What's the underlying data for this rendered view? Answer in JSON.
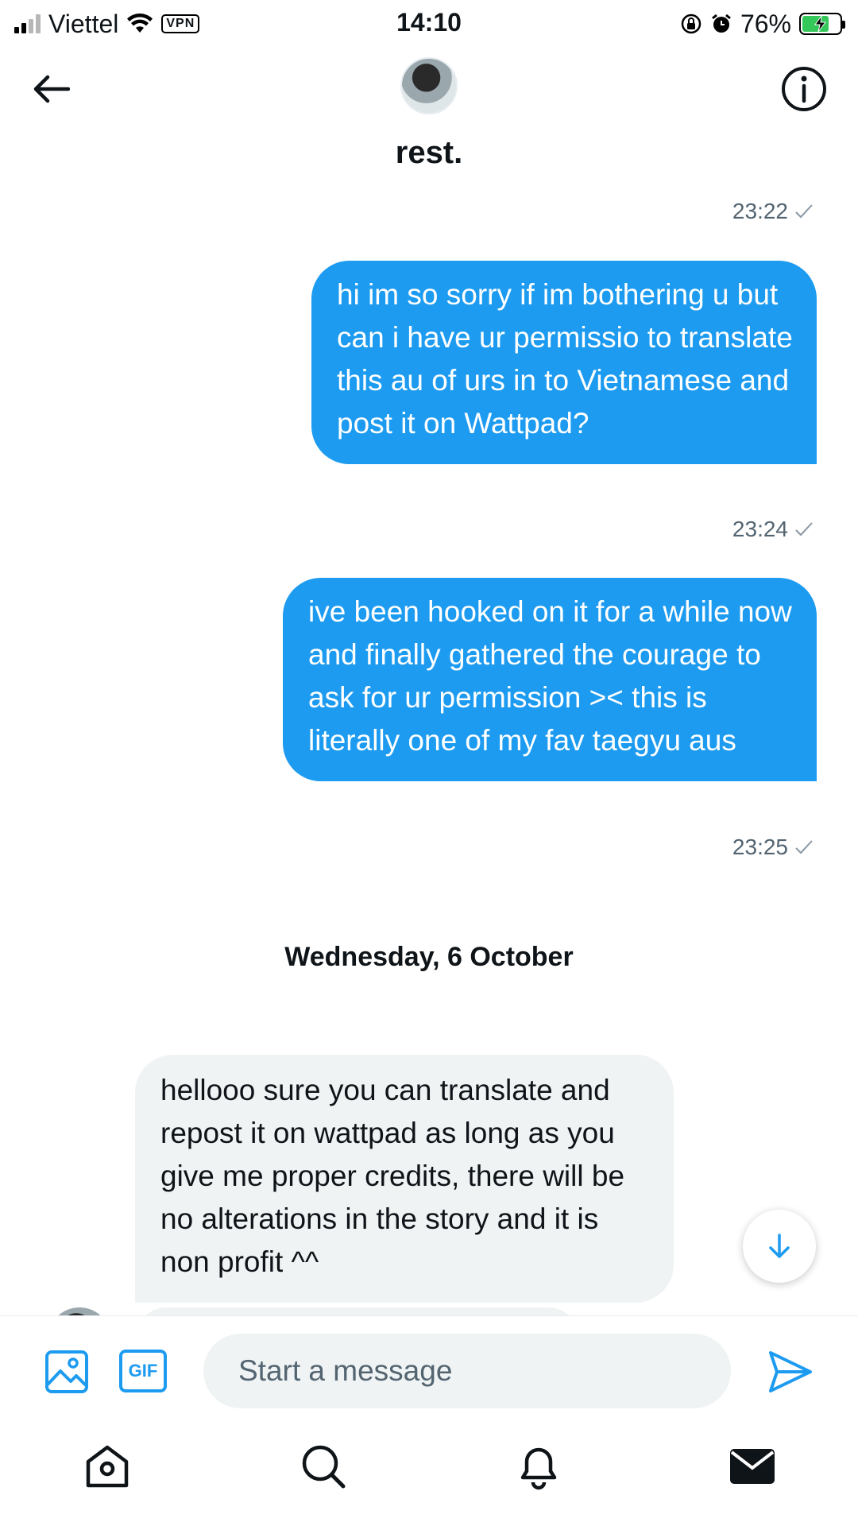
{
  "status_bar": {
    "carrier": "Viettel",
    "vpn": "VPN",
    "time": "14:10",
    "battery": "76%"
  },
  "header": {
    "name": "rest."
  },
  "messages": {
    "t1": "23:22",
    "m1": "hi im so sorry if im bothering u but can i have ur permissio to translate this au of urs in to Vietnamese and post it on Wattpad?",
    "t2": "23:24",
    "m2": "ive been hooked on it for a while now and finally gathered the courage to ask for ur permission >< this is literally one of my fav taegyu aus",
    "t3": "23:25",
    "date_divider": "Wednesday, 6 October",
    "m3": "hellooo sure you can translate and repost it on wattpad as long as you give me proper credits, there will be no alterations in the story and it is non profit ^^"
  },
  "composer": {
    "gif_label": "GIF",
    "placeholder": "Start a message"
  },
  "colors": {
    "accent": "#1d9bf0",
    "incoming_bubble": "#eff3f4",
    "battery_fill": "#34c759"
  },
  "icons": [
    "back-arrow-icon",
    "info-icon",
    "image-icon",
    "send-icon",
    "home-icon",
    "search-icon",
    "bell-icon",
    "mail-icon",
    "arrow-down-icon",
    "check-icon"
  ]
}
